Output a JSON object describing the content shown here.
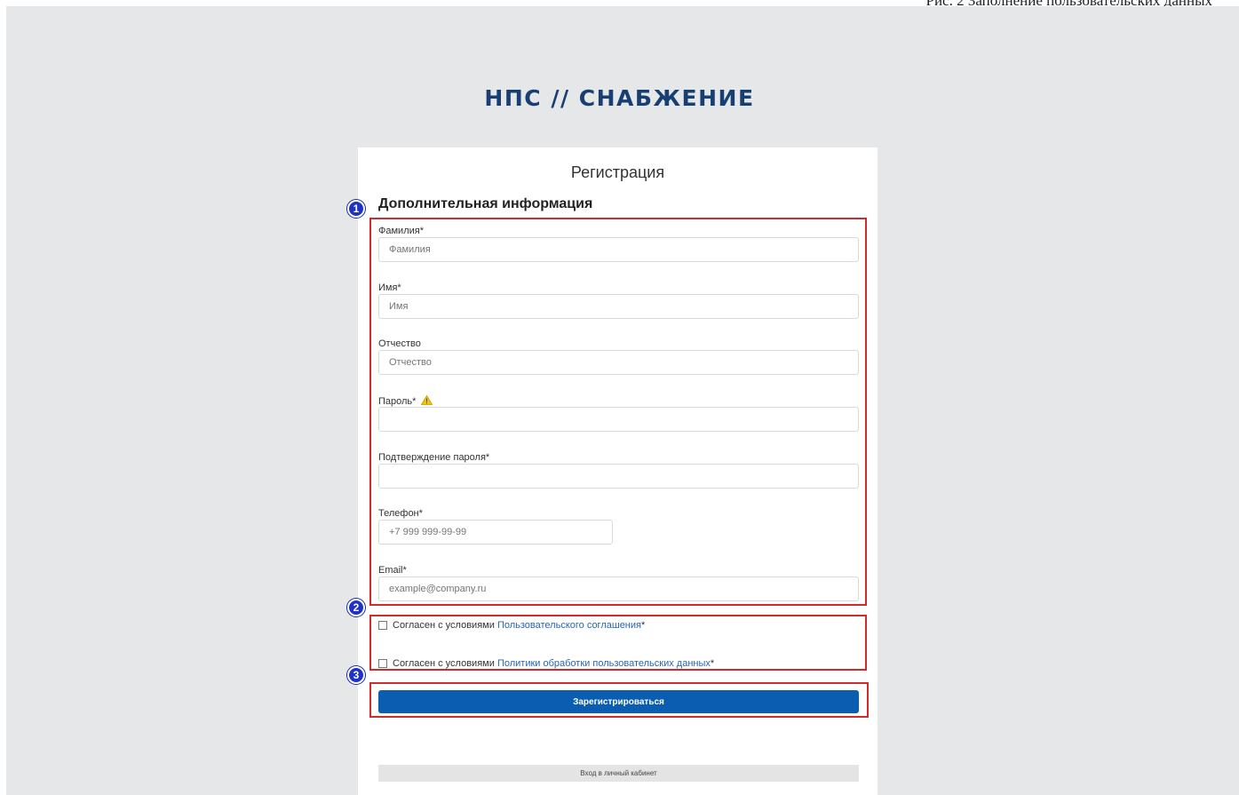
{
  "document": {
    "caption": "Рис. 2 Заполнение пользовательских данных"
  },
  "brand": {
    "logo_text": "НПС // СНАБЖЕНИЕ",
    "color": "#173f73"
  },
  "form": {
    "title": "Регистрация",
    "section_title": "Дополнительная информация",
    "fields": {
      "last_name": {
        "label": "Фамилия*",
        "placeholder": "Фамилия"
      },
      "first_name": {
        "label": "Имя*",
        "placeholder": "Имя"
      },
      "middle_name": {
        "label": "Отчество",
        "placeholder": "Отчество"
      },
      "password": {
        "label": "Пароль*",
        "placeholder": ""
      },
      "password_confirm": {
        "label": "Подтверждение пароля*",
        "placeholder": ""
      },
      "phone": {
        "label": "Телефон*",
        "placeholder": "+7 999 999-99-99"
      },
      "email": {
        "label": "Email*",
        "placeholder": "example@company.ru"
      }
    },
    "agreements": [
      {
        "prefix": "Согласен с условиями ",
        "link": "Пользовательского соглашения",
        "suffix": "*",
        "checked": false
      },
      {
        "prefix": "Согласен с условиями ",
        "link": "Политики обработки пользовательских данных",
        "suffix": "*",
        "checked": false
      }
    ],
    "submit_label": "Зарегистрироваться",
    "login_link": "Вход в личный кабинет"
  },
  "annotations": {
    "markers": [
      "1",
      "2",
      "3"
    ],
    "highlight_color": "#d22a2a"
  },
  "colors": {
    "primary_button": "#0b5db1",
    "link": "#2866b3",
    "background": "#e6e7e9",
    "warning": "#f1c40f"
  }
}
